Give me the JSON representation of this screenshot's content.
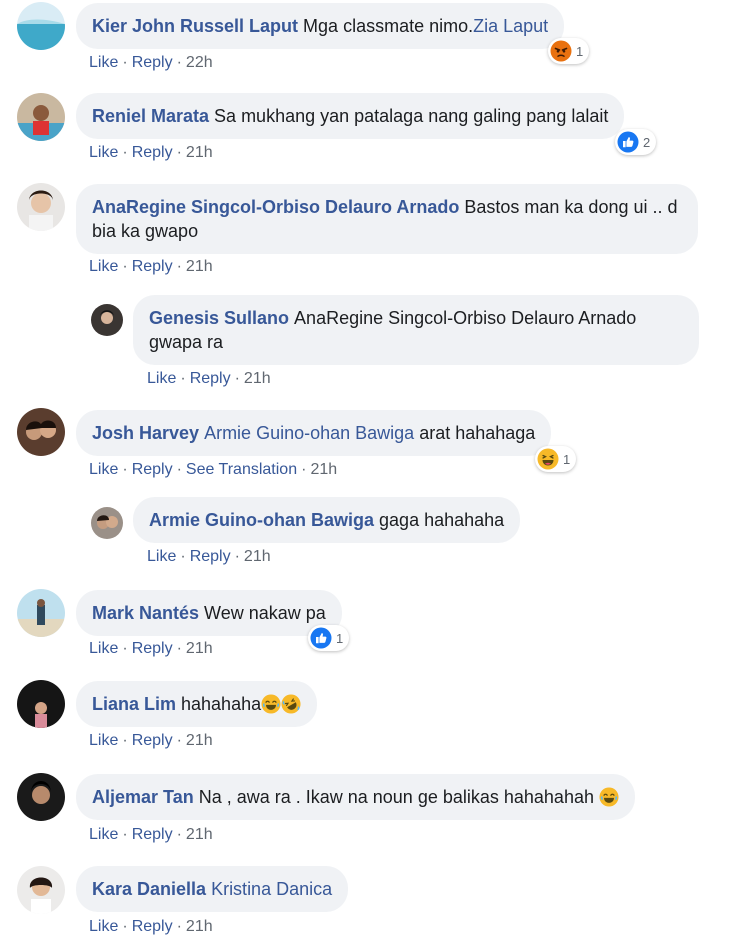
{
  "comments": [
    {
      "name": "Kier John Russell Laput",
      "text": "Mga classmate nimo.",
      "mention": "Zia Laput",
      "like": "Like",
      "reply": "Reply",
      "time": "22h",
      "reaction": {
        "type": "angry",
        "count": "1"
      }
    },
    {
      "name": "Reniel Marata",
      "text": "Sa mukhang yan patalaga nang galing pang lalait",
      "like": "Like",
      "reply": "Reply",
      "time": "21h",
      "reaction": {
        "type": "like",
        "count": "2"
      }
    },
    {
      "name": "AnaRegine Singcol-Orbiso Delauro Arnado",
      "text": "Bastos man ka dong ui .. d bia ka gwapo",
      "like": "Like",
      "reply": "Reply",
      "time": "21h"
    },
    {
      "name": "Genesis Sullano",
      "text": "AnaRegine Singcol-Orbiso Delauro Arnado gwapa ra",
      "like": "Like",
      "reply": "Reply",
      "time": "21h"
    },
    {
      "name": "Josh Harvey",
      "mention": "Armie Guino-ohan Bawiga",
      "text": "arat hahahaga",
      "like": "Like",
      "reply": "Reply",
      "translate": "See Translation",
      "time": "21h",
      "reaction": {
        "type": "haha",
        "count": "1"
      }
    },
    {
      "name": "Armie Guino-ohan Bawiga",
      "text": "gaga hahahaha",
      "like": "Like",
      "reply": "Reply",
      "time": "21h"
    },
    {
      "name": "Mark Nantés",
      "text": "Wew nakaw pa",
      "like": "Like",
      "reply": "Reply",
      "time": "21h",
      "reaction": {
        "type": "like",
        "count": "1"
      }
    },
    {
      "name": "Liana Lim",
      "text": "hahahaha",
      "like": "Like",
      "reply": "Reply",
      "time": "21h"
    },
    {
      "name": "Aljemar Tan",
      "text": "Na , awa ra . Ikaw na noun ge balikas hahahahah",
      "like": "Like",
      "reply": "Reply",
      "time": "21h"
    },
    {
      "name": "Kara Daniella",
      "mention": "Kristina Danica",
      "like": "Like",
      "reply": "Reply",
      "time": "21h"
    }
  ],
  "icons": {
    "like": "like-reaction-icon",
    "haha": "haha-reaction-icon",
    "angry": "angry-reaction-icon"
  },
  "colors": {
    "link": "#385898",
    "bubble": "#f0f2f5",
    "meta": "#606770",
    "like_blue": "#1877f2",
    "haha_yellow": "#f7b928",
    "angry_orange": "#e9710f"
  }
}
